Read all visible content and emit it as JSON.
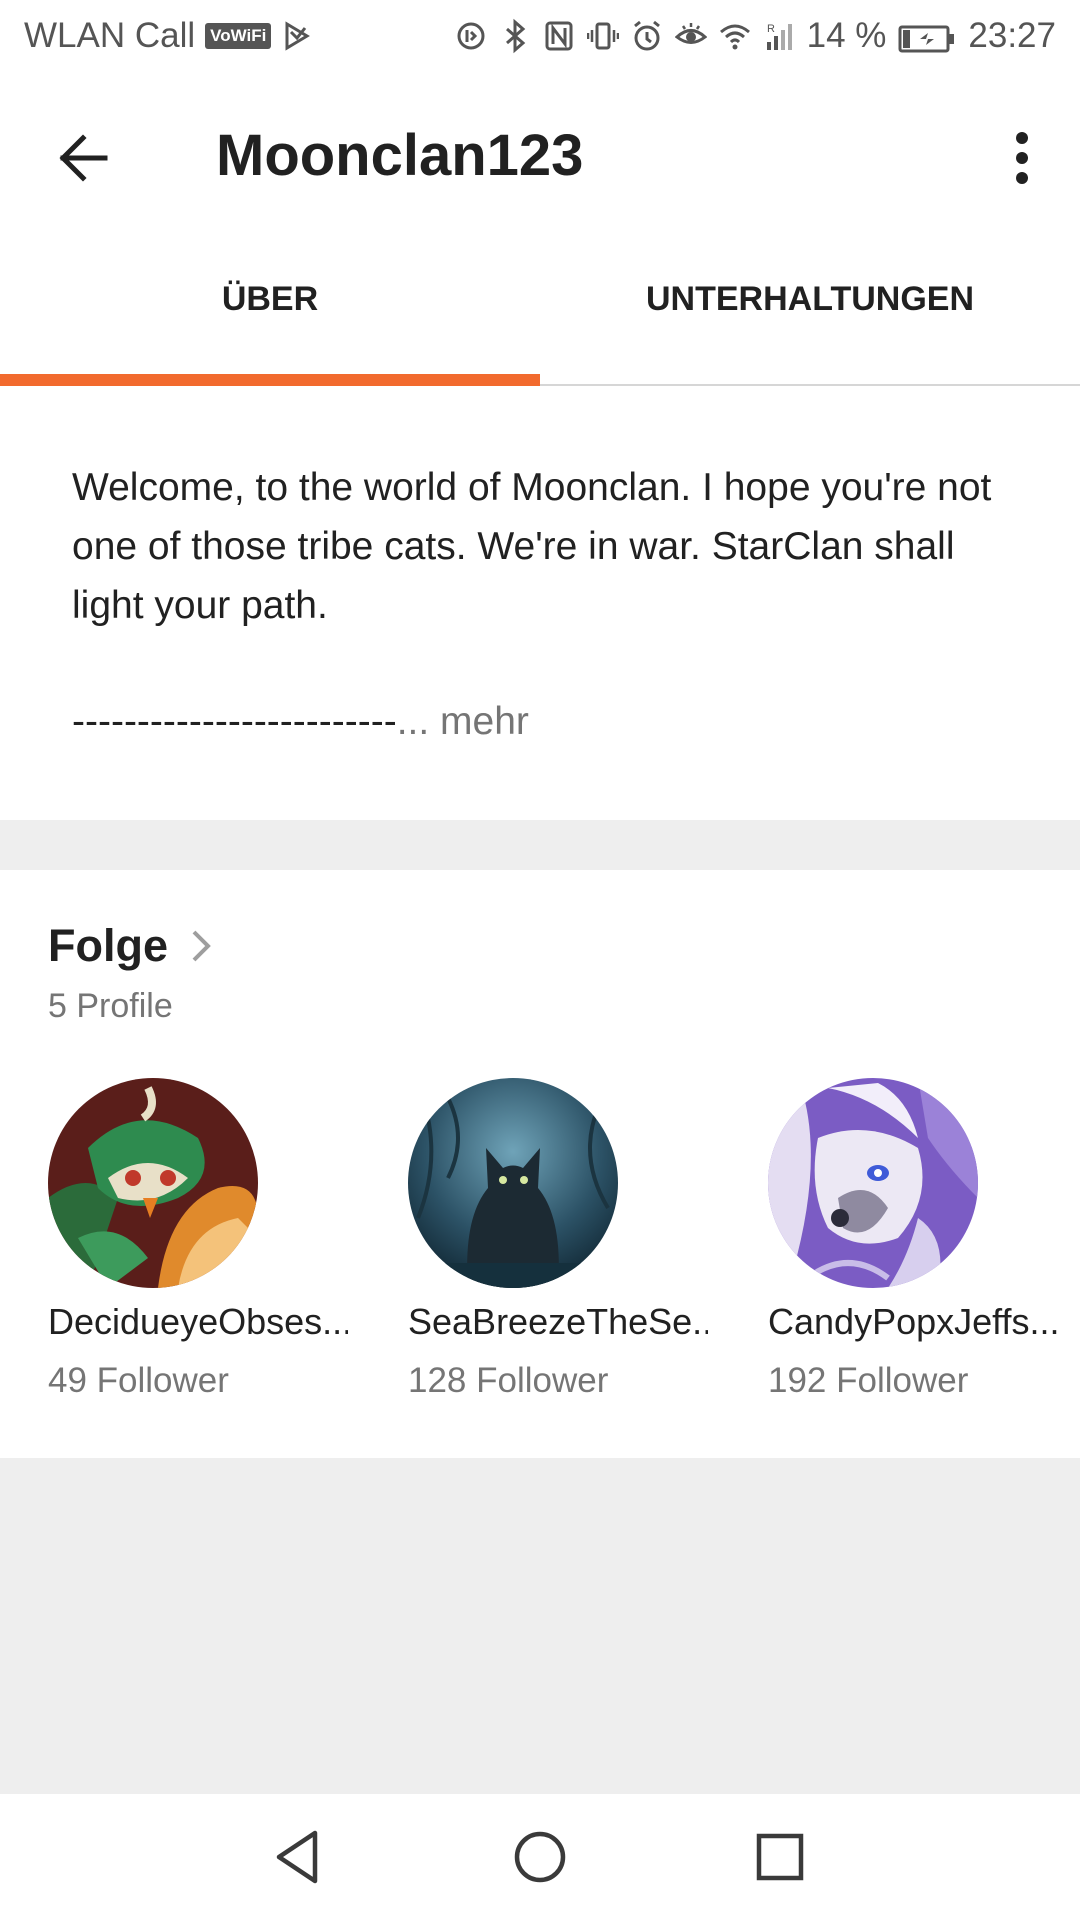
{
  "status_bar": {
    "carrier_text": "WLAN Call",
    "vowifi_badge": "VoWiFi",
    "battery_percent": "14 %",
    "time": "23:27",
    "icons": [
      "play-store-icon",
      "data-saver-icon",
      "bluetooth-icon",
      "nfc-icon",
      "vibrate-icon",
      "alarm-icon",
      "eye-comfort-icon",
      "wifi-icon",
      "signal-icon",
      "battery-charging-icon"
    ],
    "signal_roaming_letter": "R"
  },
  "app_bar": {
    "title": "Moonclan123",
    "back_icon": "arrow-left-icon",
    "menu_icon": "more-vertical-icon"
  },
  "tabs": [
    {
      "label": "ÜBER",
      "selected": true
    },
    {
      "label": "UNTERHALTUNGEN",
      "selected": false
    }
  ],
  "colors": {
    "accent": "#f26a2e",
    "text_primary": "#212121",
    "text_secondary": "#757575",
    "background_band": "#eeeeee"
  },
  "about": {
    "bio": "Welcome, to the world of Moonclan. I hope you're not one of those tribe cats. We're in war. StarClan shall light your path.",
    "dashes": "-------------------------",
    "more_label": "... mehr"
  },
  "following": {
    "title": "Folge",
    "count_label": "5 Profile",
    "profiles": [
      {
        "name": "DecidueyeObses...",
        "followers": "49 Follower",
        "avatar": "decidueye-owl-avatar"
      },
      {
        "name": "SeaBreezeTheSe...",
        "followers": "128 Follower",
        "avatar": "dark-cat-avatar"
      },
      {
        "name": "CandyPopxJeffs...",
        "followers": "192 Follower",
        "avatar": "purple-wolf-avatar"
      }
    ]
  },
  "nav_bar": {
    "back_icon": "triangle-back-icon",
    "home_icon": "circle-home-icon",
    "recents_icon": "square-recents-icon"
  }
}
